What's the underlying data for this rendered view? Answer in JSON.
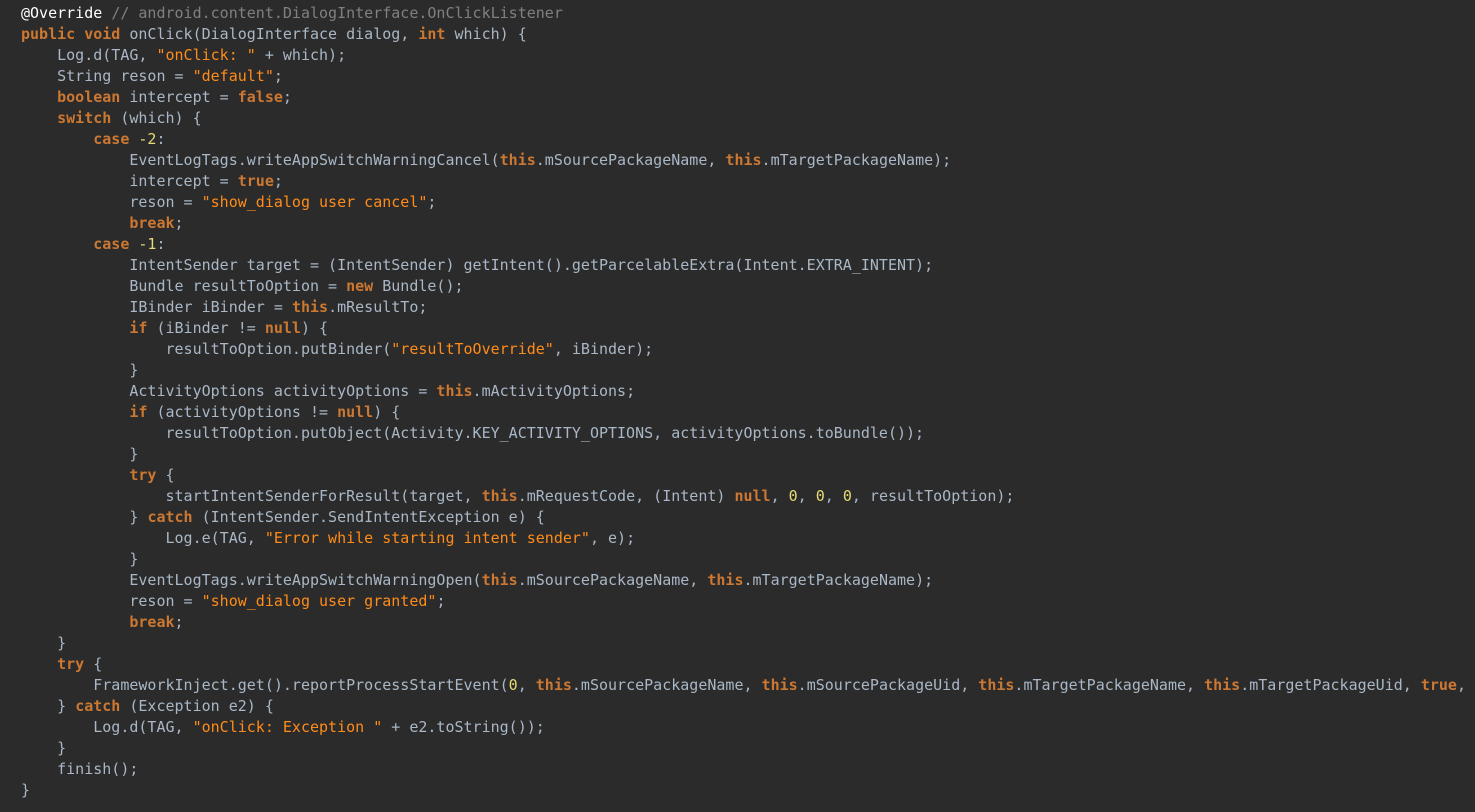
{
  "theme": {
    "background": "#2b2b2b",
    "text": "#a9b7c6",
    "keyword": "#cc7832",
    "string": "#ff8c1a",
    "number": "#e6db74",
    "comment": "#808080",
    "annotation": "#ffffff"
  },
  "code": {
    "lines": [
      [
        [
          "a",
          "@Override"
        ],
        [
          "p",
          " "
        ],
        [
          "c",
          "// android.content.DialogInterface.OnClickListener"
        ]
      ],
      [
        [
          "k",
          "public"
        ],
        [
          "p",
          " "
        ],
        [
          "k",
          "void"
        ],
        [
          "p",
          " onClick(DialogInterface dialog, "
        ],
        [
          "k",
          "int"
        ],
        [
          "p",
          " which) {"
        ]
      ],
      [
        [
          "p",
          "    Log.d(TAG, "
        ],
        [
          "s",
          "\"onClick: \""
        ],
        [
          "p",
          " + which);"
        ]
      ],
      [
        [
          "p",
          "    String reson = "
        ],
        [
          "s",
          "\"default\""
        ],
        [
          "p",
          ";"
        ]
      ],
      [
        [
          "p",
          "    "
        ],
        [
          "k",
          "boolean"
        ],
        [
          "p",
          " intercept = "
        ],
        [
          "k",
          "false"
        ],
        [
          "p",
          ";"
        ]
      ],
      [
        [
          "p",
          "    "
        ],
        [
          "k",
          "switch"
        ],
        [
          "p",
          " (which) {"
        ]
      ],
      [
        [
          "p",
          "        "
        ],
        [
          "k",
          "case"
        ],
        [
          "p",
          " "
        ],
        [
          "n",
          "-2"
        ],
        [
          "p",
          ":"
        ]
      ],
      [
        [
          "p",
          "            EventLogTags.writeAppSwitchWarningCancel("
        ],
        [
          "k",
          "this"
        ],
        [
          "p",
          ".mSourcePackageName, "
        ],
        [
          "k",
          "this"
        ],
        [
          "p",
          ".mTargetPackageName);"
        ]
      ],
      [
        [
          "p",
          "            intercept = "
        ],
        [
          "k",
          "true"
        ],
        [
          "p",
          ";"
        ]
      ],
      [
        [
          "p",
          "            reson = "
        ],
        [
          "s",
          "\"show_dialog user cancel\""
        ],
        [
          "p",
          ";"
        ]
      ],
      [
        [
          "p",
          "            "
        ],
        [
          "k",
          "break"
        ],
        [
          "p",
          ";"
        ]
      ],
      [
        [
          "p",
          "        "
        ],
        [
          "k",
          "case"
        ],
        [
          "p",
          " "
        ],
        [
          "n",
          "-1"
        ],
        [
          "p",
          ":"
        ]
      ],
      [
        [
          "p",
          "            IntentSender target = (IntentSender) getIntent().getParcelableExtra(Intent.EXTRA_INTENT);"
        ]
      ],
      [
        [
          "p",
          "            Bundle resultToOption = "
        ],
        [
          "k",
          "new"
        ],
        [
          "p",
          " Bundle();"
        ]
      ],
      [
        [
          "p",
          "            IBinder iBinder = "
        ],
        [
          "k",
          "this"
        ],
        [
          "p",
          ".mResultTo;"
        ]
      ],
      [
        [
          "p",
          "            "
        ],
        [
          "k",
          "if"
        ],
        [
          "p",
          " (iBinder != "
        ],
        [
          "k",
          "null"
        ],
        [
          "p",
          ") {"
        ]
      ],
      [
        [
          "p",
          "                resultToOption.putBinder("
        ],
        [
          "s",
          "\"resultToOverride\""
        ],
        [
          "p",
          ", iBinder);"
        ]
      ],
      [
        [
          "p",
          "            }"
        ]
      ],
      [
        [
          "p",
          "            ActivityOptions activityOptions = "
        ],
        [
          "k",
          "this"
        ],
        [
          "p",
          ".mActivityOptions;"
        ]
      ],
      [
        [
          "p",
          "            "
        ],
        [
          "k",
          "if"
        ],
        [
          "p",
          " (activityOptions != "
        ],
        [
          "k",
          "null"
        ],
        [
          "p",
          ") {"
        ]
      ],
      [
        [
          "p",
          "                resultToOption.putObject(Activity.KEY_ACTIVITY_OPTIONS, activityOptions.toBundle());"
        ]
      ],
      [
        [
          "p",
          "            }"
        ]
      ],
      [
        [
          "p",
          "            "
        ],
        [
          "k",
          "try"
        ],
        [
          "p",
          " {"
        ]
      ],
      [
        [
          "p",
          "                startIntentSenderForResult(target, "
        ],
        [
          "k",
          "this"
        ],
        [
          "p",
          ".mRequestCode, (Intent) "
        ],
        [
          "k",
          "null"
        ],
        [
          "p",
          ", "
        ],
        [
          "n",
          "0"
        ],
        [
          "p",
          ", "
        ],
        [
          "n",
          "0"
        ],
        [
          "p",
          ", "
        ],
        [
          "n",
          "0"
        ],
        [
          "p",
          ", resultToOption);"
        ]
      ],
      [
        [
          "p",
          "            } "
        ],
        [
          "k",
          "catch"
        ],
        [
          "p",
          " (IntentSender.SendIntentException e) {"
        ]
      ],
      [
        [
          "p",
          "                Log.e(TAG, "
        ],
        [
          "s",
          "\"Error while starting intent sender\""
        ],
        [
          "p",
          ", e);"
        ]
      ],
      [
        [
          "p",
          "            }"
        ]
      ],
      [
        [
          "p",
          "            EventLogTags.writeAppSwitchWarningOpen("
        ],
        [
          "k",
          "this"
        ],
        [
          "p",
          ".mSourcePackageName, "
        ],
        [
          "k",
          "this"
        ],
        [
          "p",
          ".mTargetPackageName);"
        ]
      ],
      [
        [
          "p",
          "            reson = "
        ],
        [
          "s",
          "\"show_dialog user granted\""
        ],
        [
          "p",
          ";"
        ]
      ],
      [
        [
          "p",
          "            "
        ],
        [
          "k",
          "break"
        ],
        [
          "p",
          ";"
        ]
      ],
      [
        [
          "p",
          "    }"
        ]
      ],
      [
        [
          "p",
          "    "
        ],
        [
          "k",
          "try"
        ],
        [
          "p",
          " {"
        ]
      ],
      [
        [
          "p",
          "        FrameworkInject.get().reportProcessStartEvent("
        ],
        [
          "n",
          "0"
        ],
        [
          "p",
          ", "
        ],
        [
          "k",
          "this"
        ],
        [
          "p",
          ".mSourcePackageName, "
        ],
        [
          "k",
          "this"
        ],
        [
          "p",
          ".mSourcePackageUid, "
        ],
        [
          "k",
          "this"
        ],
        [
          "p",
          ".mTargetPackageName, "
        ],
        [
          "k",
          "this"
        ],
        [
          "p",
          ".mTargetPackageUid, "
        ],
        [
          "k",
          "true"
        ],
        [
          "p",
          ", r"
        ]
      ],
      [
        [
          "p",
          "    } "
        ],
        [
          "k",
          "catch"
        ],
        [
          "p",
          " (Exception e2) {"
        ]
      ],
      [
        [
          "p",
          "        Log.d(TAG, "
        ],
        [
          "s",
          "\"onClick: Exception \""
        ],
        [
          "p",
          " + e2.toString());"
        ]
      ],
      [
        [
          "p",
          "    }"
        ]
      ],
      [
        [
          "p",
          "    finish();"
        ]
      ],
      [
        [
          "p",
          "}"
        ]
      ]
    ]
  }
}
